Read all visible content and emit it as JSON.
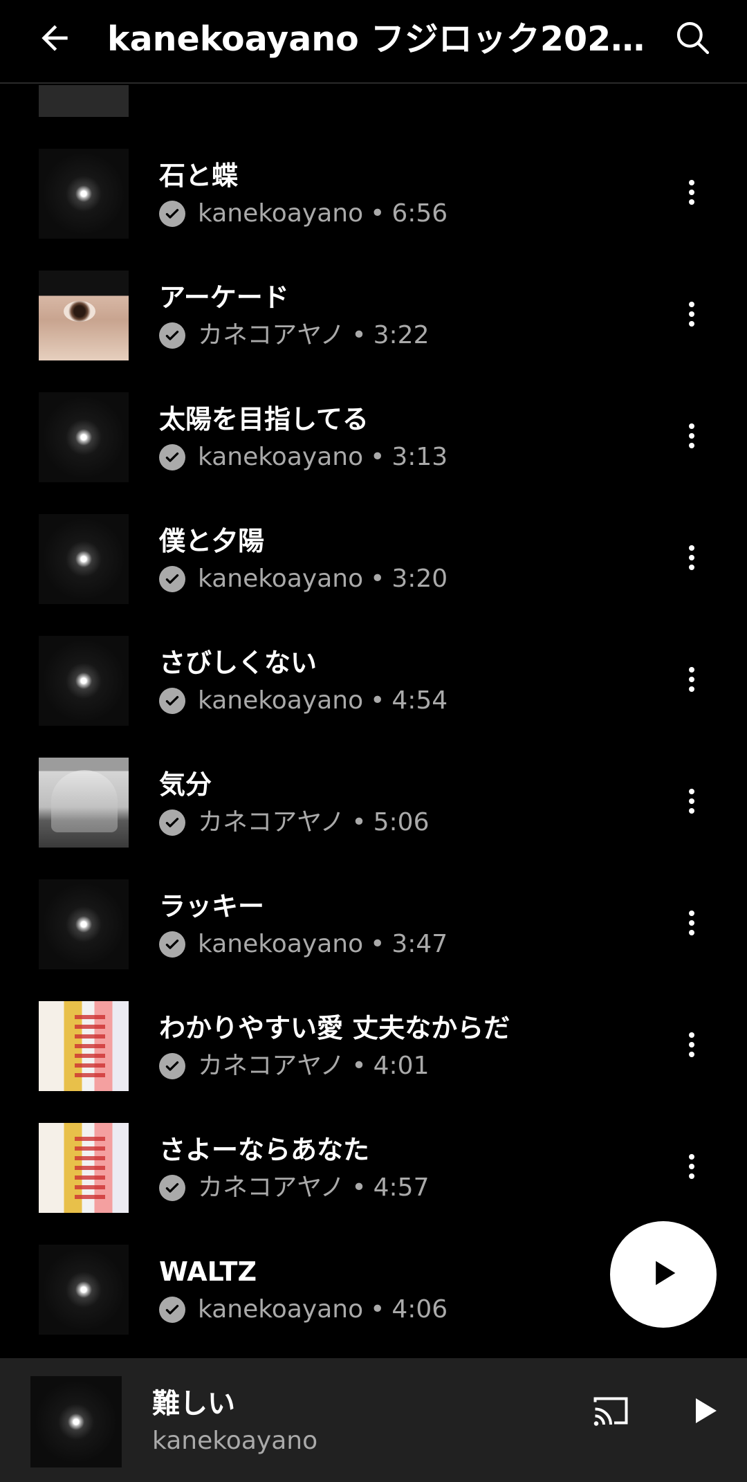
{
  "header": {
    "title": "kanekoayano フジロック2025…",
    "back_icon": "arrow-left-icon",
    "search_icon": "search-icon"
  },
  "songs": [
    {
      "title": "石と蝶",
      "artist": "kanekoayano",
      "duration": "6:56",
      "art": "dark"
    },
    {
      "title": "アーケード",
      "artist": "カネコアヤノ",
      "duration": "3:22",
      "art": "eye"
    },
    {
      "title": "太陽を目指してる",
      "artist": "kanekoayano",
      "duration": "3:13",
      "art": "dark"
    },
    {
      "title": "僕と夕陽",
      "artist": "kanekoayano",
      "duration": "3:20",
      "art": "dark"
    },
    {
      "title": "さびしくない",
      "artist": "kanekoayano",
      "duration": "4:54",
      "art": "dark"
    },
    {
      "title": "気分",
      "artist": "カネコアヤノ",
      "duration": "5:06",
      "art": "dome"
    },
    {
      "title": "ラッキー",
      "artist": "kanekoayano",
      "duration": "3:47",
      "art": "dark"
    },
    {
      "title": "わかりやすい愛 丈夫なからだ",
      "artist": "カネコアヤノ",
      "duration": "4:01",
      "art": "collage"
    },
    {
      "title": "さよーならあなた",
      "artist": "カネコアヤノ",
      "duration": "4:57",
      "art": "collage"
    },
    {
      "title": "WALTZ",
      "artist": "kanekoayano",
      "duration": "4:06",
      "art": "dark"
    }
  ],
  "separator": "•",
  "icons": {
    "verified": "verified-check-icon",
    "more": "more-vert-icon",
    "play": "play-icon",
    "cast": "cast-icon"
  },
  "now_playing": {
    "title": "難しい",
    "artist": "kanekoayano"
  },
  "colors": {
    "background": "#000000",
    "secondary_text": "#aaaaaa",
    "mini_player_bg": "#212121",
    "fab": "#ffffff"
  }
}
